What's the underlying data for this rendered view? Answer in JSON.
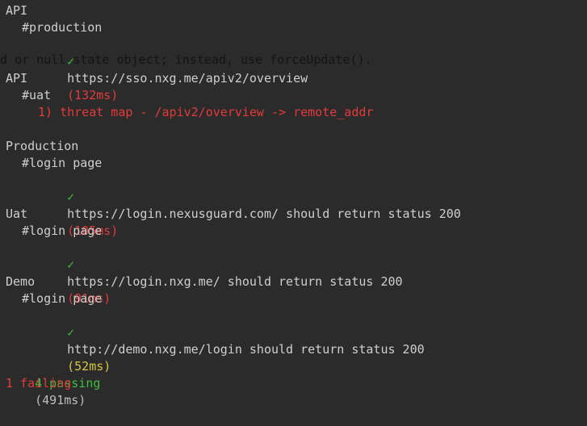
{
  "warning_overlay": "d or null state object; instead, use forceUpdate().",
  "blocks": [
    {
      "suite": "API",
      "context": "#production",
      "result": {
        "mark": "✓",
        "text": "https://sso.nxg.me/apiv2/overview",
        "duration": "(132ms)",
        "duration_color": "#e23b3b"
      }
    },
    {
      "suite": "API",
      "context": "#uat",
      "failure": "1) threat map - /apiv2/overview -> remote_addr"
    },
    {
      "suite": "Production",
      "context": "#login page",
      "result": {
        "mark": "✓",
        "text": "https://login.nexusguard.com/ should return status 200",
        "duration": "(105ms)",
        "duration_color": "#e23b3b"
      }
    },
    {
      "suite": "Uat",
      "context": "#login page",
      "result": {
        "mark": "✓",
        "text": "https://login.nxg.me/ should return status 200",
        "duration": "(91ms)",
        "duration_color": "#e23b3b"
      }
    },
    {
      "suite": "Demo",
      "context": "#login page",
      "result": {
        "mark": "✓",
        "text": "http://demo.nxg.me/login should return status 200",
        "duration": "(52ms)",
        "duration_color": "#d8c640"
      }
    }
  ],
  "summary": {
    "passing": "4 passing",
    "passing_duration": "(491ms)",
    "failing": "1 failing"
  }
}
